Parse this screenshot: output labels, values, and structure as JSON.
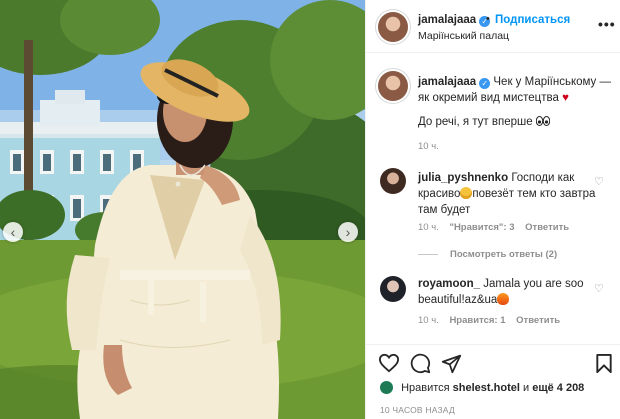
{
  "post": {
    "username": "jamalajaaa",
    "follow_label": "Подписаться",
    "separator": "•",
    "location": "Маріїнський палац",
    "more_label": "•••"
  },
  "caption": {
    "username": "jamalajaaa",
    "text": "Чек у Маріїнському — як окремий вид мистецтва",
    "line2": "До речі, я тут вперше",
    "time": "10 ч."
  },
  "comments": [
    {
      "username": "julia_pyshnenko",
      "text_before": "Господи как красиво",
      "text_after": "повезёт тем кто завтра там будет",
      "time": "10 ч.",
      "likes": "\"Нравится\": 3",
      "reply": "Ответить"
    },
    {
      "username": "royamoon_",
      "text_before": "Jamala you are soo beautiful!az&ua",
      "text_after": "",
      "time": "10 ч.",
      "likes": "Нравится: 1",
      "reply": "Ответить"
    }
  ],
  "view_replies": "Посмотреть ответы (2)",
  "likes_bar": {
    "prefix": "Нравится",
    "user": "shelest.hotel",
    "connector": "и",
    "count": "ещё 4 208"
  },
  "timestamp": "10 ЧАСОВ НАЗАД",
  "icons": {
    "verified": "verified-badge-icon",
    "caption_heart": "red-heart-emoji",
    "comment_like": "heart-outline-icon",
    "like": "heart-outline-icon",
    "comment": "comment-bubble-icon",
    "share": "paper-plane-icon",
    "save": "bookmark-icon",
    "nav_left": "chevron-left-icon",
    "nav_right": "chevron-right-icon"
  },
  "colors": {
    "follow": "#0095f6",
    "verified": "#3897f0",
    "heart_emoji": "#d0021b",
    "meta": "#8e8e8e"
  }
}
